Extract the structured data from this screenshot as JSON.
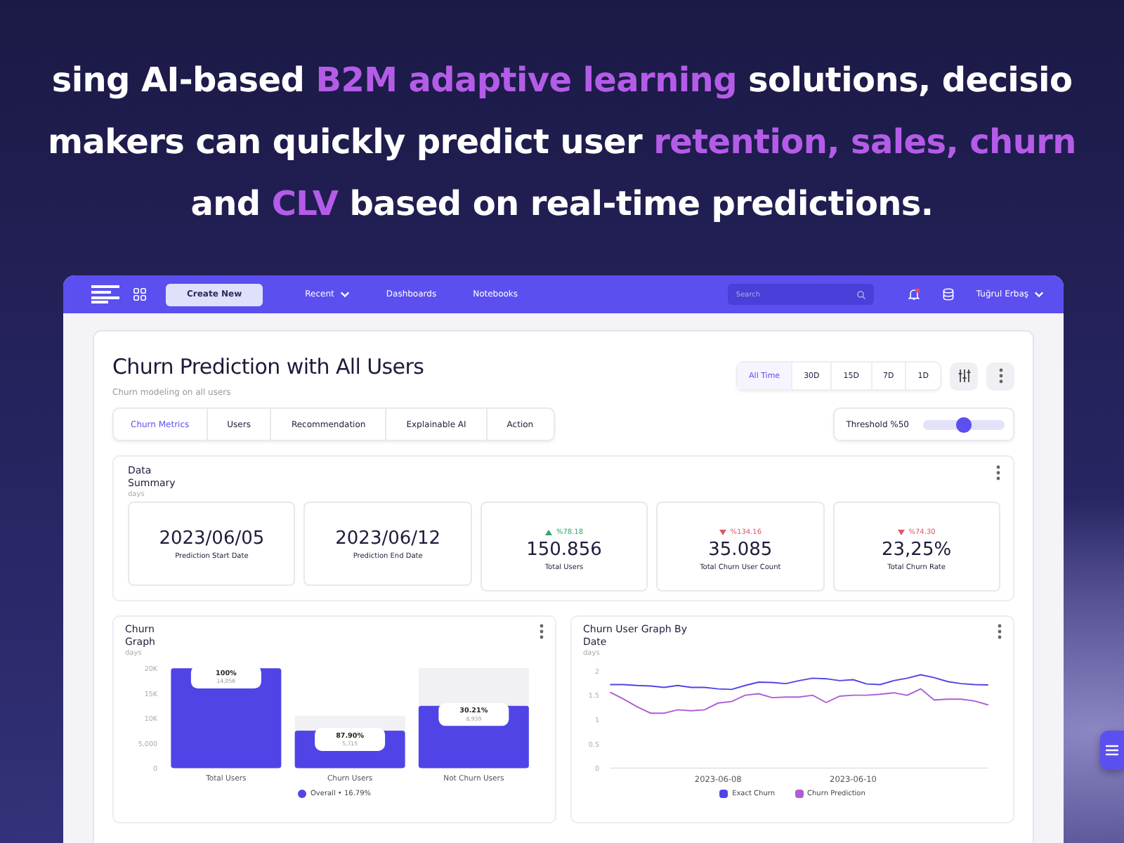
{
  "headline": {
    "lines": [
      [
        {
          "text": "sing AI-based ",
          "highlight": false
        },
        {
          "text": "B2M adaptive learning",
          "highlight": true
        },
        {
          "text": " solutions, decisio",
          "highlight": false
        }
      ],
      [
        {
          "text": "makers can quickly predict user ",
          "highlight": false
        },
        {
          "text": "retention, sales, churn",
          "highlight": true
        }
      ],
      [
        {
          "text": "and ",
          "highlight": false
        },
        {
          "text": "CLV",
          "highlight": true
        },
        {
          "text": " based on real-time predictions.",
          "highlight": false
        }
      ]
    ]
  },
  "nav": {
    "create_button": "Create New",
    "links": [
      {
        "label": "Recent",
        "dropdown": true
      },
      {
        "label": "Dashboards",
        "dropdown": false
      },
      {
        "label": "Notebooks",
        "dropdown": false
      }
    ],
    "search": {
      "placeholder": "Search"
    },
    "user": "Tuğrul Erbaş"
  },
  "page": {
    "title": "Churn Prediction with All Users",
    "subtitle": "Churn modeling on all users",
    "ranges": [
      {
        "label": "All Time",
        "selected": true
      },
      {
        "label": "30D",
        "selected": false
      },
      {
        "label": "15D",
        "selected": false
      },
      {
        "label": "7D",
        "selected": false
      },
      {
        "label": "1D",
        "selected": false
      }
    ],
    "tabs": [
      {
        "label": "Churn Metrics",
        "selected": true
      },
      {
        "label": "Users",
        "selected": false
      },
      {
        "label": "Recommendation",
        "selected": false
      },
      {
        "label": "Explainable AI",
        "selected": false
      },
      {
        "label": "Action",
        "selected": false
      }
    ],
    "threshold": {
      "label": "Threshold %50",
      "level": 0.5
    }
  },
  "summary": {
    "title": "Data Summary",
    "subtitle": "days",
    "cards": [
      {
        "kind": "date",
        "value": "2023/06/05",
        "label": "Prediction Start Date"
      },
      {
        "kind": "date",
        "value": "2023/06/12",
        "label": "Prediction End Date"
      },
      {
        "kind": "metric",
        "change": "%78.18",
        "rising": true,
        "value": "150.856",
        "label": "Total Users"
      },
      {
        "kind": "metric",
        "change": "%134.16",
        "rising": false,
        "value": "35.085",
        "label": "Total Churn User Count"
      },
      {
        "kind": "metric",
        "change": "%74.30",
        "rising": false,
        "value": "23,25%",
        "label": "Total Churn Rate"
      }
    ]
  },
  "bar_panel": {
    "title": "Churn Graph",
    "subtitle": "days",
    "legend_value": "• 16.79%",
    "bar_labels": [
      {
        "percent": "100%",
        "count": "14,056"
      },
      {
        "percent": "87.90%",
        "count": "5,715"
      },
      {
        "percent": "30.21%",
        "count": "8,939"
      }
    ],
    "chart_data": {
      "type": "bar",
      "categories": [
        "Total Users",
        "Churn Users",
        "Not Churn Users"
      ],
      "series": [
        {
          "name": "Overall",
          "color": "#5044e6",
          "values": [
            20000,
            7500,
            12500
          ]
        },
        {
          "color": "#f1f1f5",
          "values": [
            null,
            3000,
            7500
          ]
        }
      ],
      "stacked": true,
      "ylim": [
        0,
        20000
      ],
      "yticks": [
        0,
        {
          "value": 5000,
          "label": "5,000"
        },
        {
          "value": 10000,
          "label": "10K"
        },
        {
          "value": 15000,
          "label": "15K"
        },
        {
          "value": 20000,
          "label": "20K"
        }
      ]
    }
  },
  "line_panel": {
    "title": "Churn User Graph By Date",
    "subtitle": "days",
    "chart_data": {
      "type": "line",
      "categories": [
        null,
        null,
        null,
        null,
        null,
        null,
        null,
        null,
        "2023-06-08",
        null,
        null,
        null,
        null,
        null,
        null,
        null,
        null,
        null,
        "2023-06-10",
        null,
        null,
        null,
        null,
        null,
        null,
        null,
        null,
        null,
        null
      ],
      "series": [
        {
          "name": "Exact Churn",
          "color": "#5044e6",
          "values": [
            1.72,
            1.72,
            1.7,
            1.69,
            1.66,
            1.7,
            1.66,
            1.66,
            1.63,
            1.62,
            1.7,
            1.77,
            1.76,
            1.74,
            1.8,
            1.85,
            1.84,
            1.8,
            1.82,
            1.73,
            1.72,
            1.8,
            1.85,
            1.92,
            1.86,
            1.78,
            1.74,
            1.72,
            1.71
          ]
        },
        {
          "name": "Churn Prediction",
          "color": "#b05cd6",
          "values": [
            1.56,
            1.42,
            1.26,
            1.13,
            1.13,
            1.2,
            1.18,
            1.2,
            1.34,
            1.37,
            1.5,
            1.53,
            1.45,
            1.46,
            1.46,
            1.5,
            1.35,
            1.48,
            1.5,
            1.5,
            1.52,
            1.55,
            1.5,
            1.63,
            1.4,
            1.42,
            1.42,
            1.38,
            1.3
          ]
        }
      ],
      "ylim": [
        0,
        2
      ],
      "yticks": [
        0,
        0.5,
        1,
        1.5,
        2
      ]
    }
  }
}
